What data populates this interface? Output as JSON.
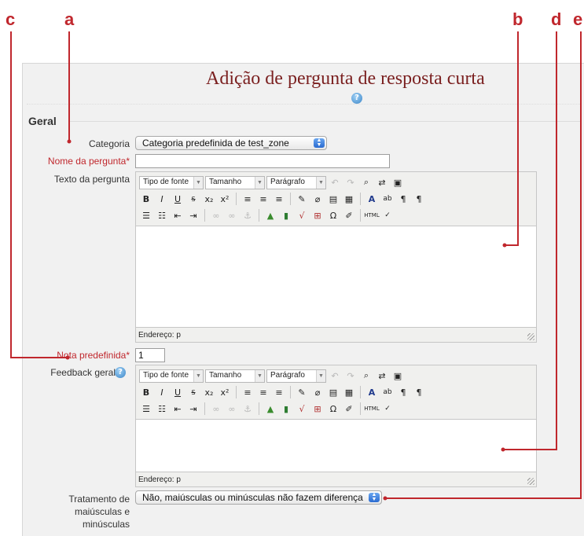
{
  "annotations": [
    "a",
    "b",
    "c",
    "d",
    "e"
  ],
  "page": {
    "title": "Adição de pergunta de resposta curta",
    "section": "Geral"
  },
  "form": {
    "category_label": "Categoria",
    "category_value": "Categoria predefinida de test_zone",
    "name_label": "Nome da pergunta",
    "name_value": "",
    "question_text_label": "Texto da pergunta",
    "default_mark_label": "Nota predefinida",
    "default_mark_value": "1",
    "general_feedback_label": "Feedback geral",
    "case_label_line1": "Tratamento de",
    "case_label_line2": "maiúsculas e",
    "case_label_line3": "minúsculas",
    "case_value": "Não, maiúsculas ou minúsculas não fazem diferença",
    "required_star": "*"
  },
  "editor": {
    "font_family": "Tipo de fonte",
    "font_size": "Tamanho",
    "paragraph": "Parágrafo",
    "path_status": "Endereço: p"
  },
  "colors": {
    "annotation": "#c0272d",
    "title": "#7a1f1f",
    "required": "#c0272d"
  },
  "icons": [
    "help-icon",
    "select-stepper-icon",
    "resize-grip-icon"
  ]
}
